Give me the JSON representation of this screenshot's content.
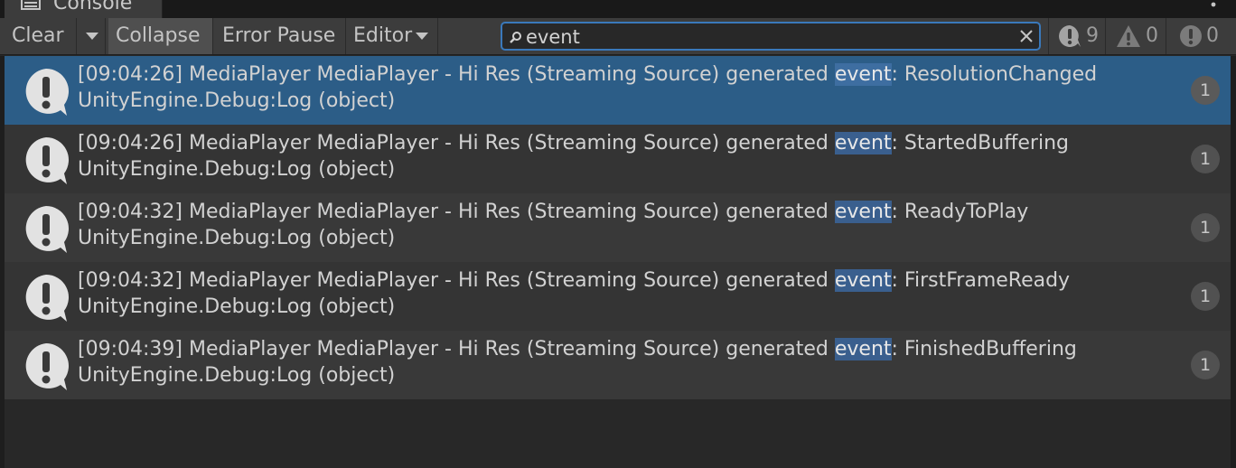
{
  "window": {
    "tab_title": "Console"
  },
  "toolbar": {
    "clear_label": "Clear",
    "collapse_label": "Collapse",
    "error_pause_label": "Error Pause",
    "editor_label": "Editor"
  },
  "search": {
    "value": "event",
    "placeholder": ""
  },
  "counters": {
    "info": "9",
    "warnings": "0",
    "errors": "0"
  },
  "entries": [
    {
      "prefix": "[09:04:26] MediaPlayer MediaPlayer - Hi Res (Streaming Source) generated ",
      "match": "event",
      "suffix": ": ResolutionChanged",
      "stack": "UnityEngine.Debug:Log (object)",
      "count": "1",
      "selected": true
    },
    {
      "prefix": "[09:04:26] MediaPlayer MediaPlayer - Hi Res (Streaming Source) generated ",
      "match": "event",
      "suffix": ": StartedBuffering",
      "stack": "UnityEngine.Debug:Log (object)",
      "count": "1",
      "selected": false
    },
    {
      "prefix": "[09:04:32] MediaPlayer MediaPlayer - Hi Res (Streaming Source) generated ",
      "match": "event",
      "suffix": ": ReadyToPlay",
      "stack": "UnityEngine.Debug:Log (object)",
      "count": "1",
      "selected": false
    },
    {
      "prefix": "[09:04:32] MediaPlayer MediaPlayer - Hi Res (Streaming Source) generated ",
      "match": "event",
      "suffix": ": FirstFrameReady",
      "stack": "UnityEngine.Debug:Log (object)",
      "count": "1",
      "selected": false
    },
    {
      "prefix": "[09:04:39] MediaPlayer MediaPlayer - Hi Res (Streaming Source) generated ",
      "match": "event",
      "suffix": ": FinishedBuffering",
      "stack": "UnityEngine.Debug:Log (object)",
      "count": "1",
      "selected": false
    }
  ],
  "colors": {
    "accent": "#3a79bb",
    "selection": "#2c5d87",
    "highlight": "#3a5f8e"
  },
  "icons": {
    "tab": "console-icon",
    "entry": "info-speech-bubble-icon",
    "search": "search-icon",
    "clear_search": "close-icon",
    "menu": "kebab-menu-icon"
  }
}
